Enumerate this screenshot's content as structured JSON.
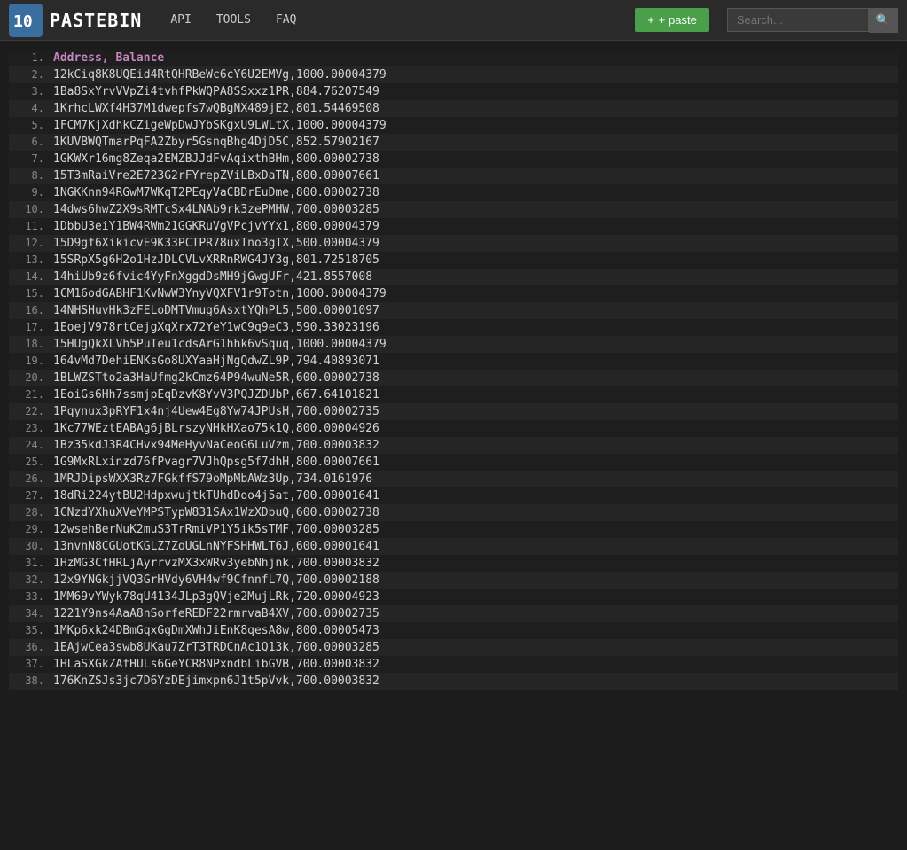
{
  "header": {
    "logo_text": "PASTEBIN",
    "nav": [
      {
        "label": "API",
        "href": "#"
      },
      {
        "label": "TOOLS",
        "href": "#"
      },
      {
        "label": "FAQ",
        "href": "#"
      }
    ],
    "paste_btn": "+ paste",
    "search_placeholder": "Search..."
  },
  "lines": [
    {
      "num": "1.",
      "content": "Address, Balance"
    },
    {
      "num": "2.",
      "content": "12kCiq8K8UQEid4RtQHRBeWc6cY6U2EMVg,1000.00004379"
    },
    {
      "num": "3.",
      "content": "1Ba8SxYrvVVpZi4tvhfPkWQPA8SSxxz1PR,884.76207549"
    },
    {
      "num": "4.",
      "content": "1KrhcLWXf4H37M1dwepfs7wQBgNX489jE2,801.54469508"
    },
    {
      "num": "5.",
      "content": "1FCM7KjXdhkCZigeWpDwJYbSKgxU9LWLtX,1000.00004379"
    },
    {
      "num": "6.",
      "content": "1KUVBWQTmarPqFA2Zbyr5GsnqBhg4DjD5C,852.57902167"
    },
    {
      "num": "7.",
      "content": "1GKWXr16mg8Zeqa2EMZBJJdFvAqixthBHm,800.00002738"
    },
    {
      "num": "8.",
      "content": "15T3mRaiVre2E723G2rFYrepZViLBxDaTN,800.00007661"
    },
    {
      "num": "9.",
      "content": "1NGKKnn94RGwM7WKqT2PEqyVaCBDrEuDme,800.00002738"
    },
    {
      "num": "10.",
      "content": "14dws6hwZ2X9sRMTcSx4LNAb9rk3zePMHW,700.00003285"
    },
    {
      "num": "11.",
      "content": "1DbbU3eiY1BW4RWm21GGKRuVgVPcjvYYx1,800.00004379"
    },
    {
      "num": "12.",
      "content": "15D9gf6XikicvE9K33PCTPR78uxTno3gTX,500.00004379"
    },
    {
      "num": "13.",
      "content": "15SRpX5g6H2o1HzJDLCVLvXRRnRWG4JY3g,801.72518705"
    },
    {
      "num": "14.",
      "content": "14hiUb9z6fvic4YyFnXggdDsMH9jGwgUFr,421.8557008"
    },
    {
      "num": "15.",
      "content": "1CM16odGABHF1KvNwW3YnyVQXFV1r9Totn,1000.00004379"
    },
    {
      "num": "16.",
      "content": "14NHSHuvHk3zFELoDMTVmug6AsxtYQhPL5,500.00001097"
    },
    {
      "num": "17.",
      "content": "1EoejV978rtCejgXqXrx72YeY1wC9q9eC3,590.33023196"
    },
    {
      "num": "18.",
      "content": "15HUgQkXLVh5PuTeu1cdsArG1hhk6vSquq,1000.00004379"
    },
    {
      "num": "19.",
      "content": "164vMd7DehiENKsGo8UXYaaHjNgQdwZL9P,794.40893071"
    },
    {
      "num": "20.",
      "content": "1BLWZSTto2a3HaUfmg2kCmz64P94wuNe5R,600.00002738"
    },
    {
      "num": "21.",
      "content": "1EoiGs6Hh7ssmjpEqDzvK8YvV3PQJZDUbP,667.64101821"
    },
    {
      "num": "22.",
      "content": "1Pqynux3pRYF1x4nj4Uew4Eg8Yw74JPUsH,700.00002735"
    },
    {
      "num": "23.",
      "content": "1Kc77WEztEABAg6jBLrszyNHkHXao75k1Q,800.00004926"
    },
    {
      "num": "24.",
      "content": "1Bz35kdJ3R4CHvx94MeHyvNaCeoG6LuVzm,700.00003832"
    },
    {
      "num": "25.",
      "content": "1G9MxRLxinzd76fPvagr7VJhQpsg5f7dhH,800.00007661"
    },
    {
      "num": "26.",
      "content": "1MRJDipsWXX3Rz7FGkffS79oMpMbAWz3Up,734.0161976"
    },
    {
      "num": "27.",
      "content": "18dRi224ytBU2HdpxwujtkTUhdDoo4j5at,700.00001641"
    },
    {
      "num": "28.",
      "content": "1CNzdYXhuXVeYMPSTypW831SAx1WzXDbuQ,600.00002738"
    },
    {
      "num": "29.",
      "content": "12wsehBerNuK2muS3TrRmiVP1Y5ik5sTMF,700.00003285"
    },
    {
      "num": "30.",
      "content": "13nvnN8CGUotKGLZ7ZoUGLnNYFSHHWLT6J,600.00001641"
    },
    {
      "num": "31.",
      "content": "1HzMG3CfHRLjAyrrvzMX3xWRv3yebNhjnk,700.00003832"
    },
    {
      "num": "32.",
      "content": "12x9YNGkjjVQ3GrHVdy6VH4wf9CfnnfL7Q,700.00002188"
    },
    {
      "num": "33.",
      "content": "1MM69vYWyk78qU4134JLp3gQVje2MujLRk,720.00004923"
    },
    {
      "num": "34.",
      "content": "1221Y9ns4AaA8nSorfeREDF22rmrvaB4XV,700.00002735"
    },
    {
      "num": "35.",
      "content": "1MKp6xk24DBmGqxGgDmXWhJiEnK8qesA8w,800.00005473"
    },
    {
      "num": "36.",
      "content": "1EAjwCea3swb8UKau7ZrT3TRDCnAc1Q13k,700.00003285"
    },
    {
      "num": "37.",
      "content": "1HLaSXGkZAfHULs6GeYCR8NPxndbLibGVB,700.00003832"
    },
    {
      "num": "38.",
      "content": "176KnZSJs3jc7D6YzDEjimxpn6J1t5pVvk,700.00003832"
    }
  ]
}
